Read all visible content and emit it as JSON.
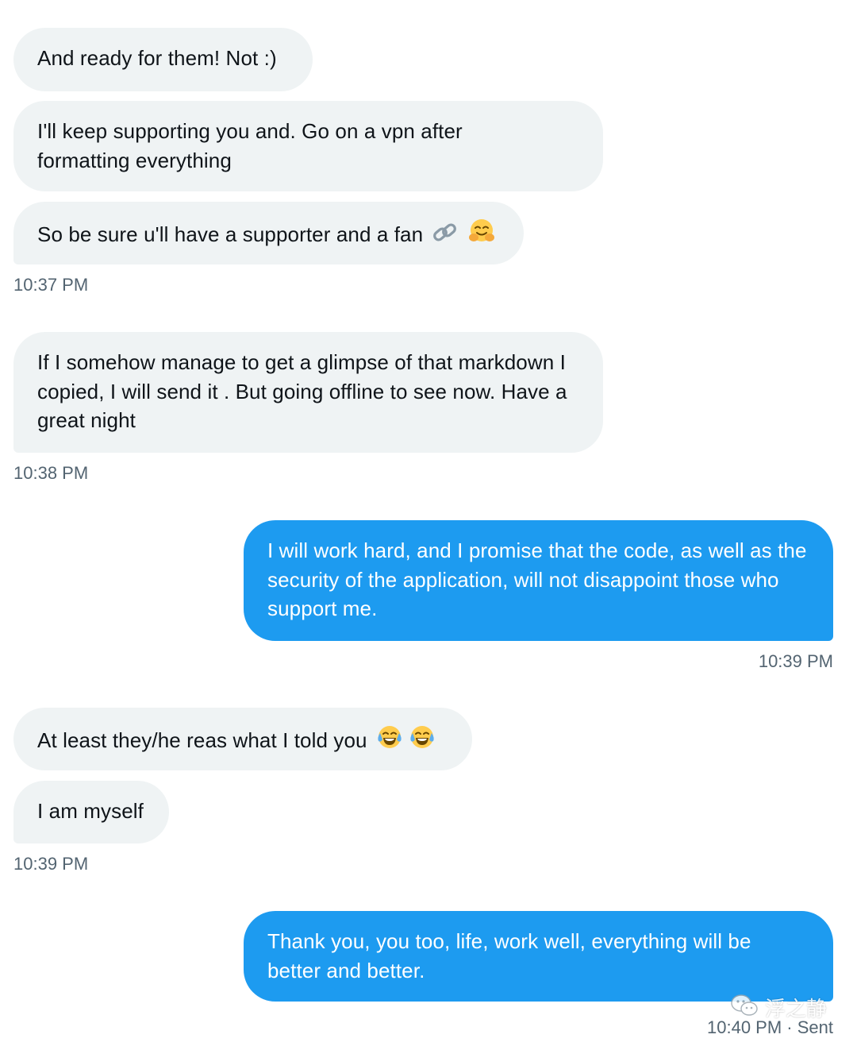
{
  "messages": [
    {
      "text": "And ready for them! Not :)"
    },
    {
      "text": "I'll keep supporting you and. Go on a vpn after formatting everything"
    },
    {
      "text": "So be sure u'll have a supporter and a fan"
    },
    {
      "time": "10:37 PM"
    },
    {
      "text": "If I somehow manage to get a glimpse of that markdown I copied, I will send it . But going offline to see now. Have a great night"
    },
    {
      "time": "10:38 PM"
    },
    {
      "text": "I will work hard, and I promise that the code, as well as the security of the application, will not disappoint those who support me."
    },
    {
      "time": "10:39 PM"
    },
    {
      "text": "At least they/he reas what I told you"
    },
    {
      "text": "I am myself"
    },
    {
      "time": "10:39 PM"
    },
    {
      "text": "Thank you, you too, life, work well, everything will be better and better."
    },
    {
      "time": "10:40 PM · Sent"
    }
  ],
  "emoji": {
    "link": "link-icon",
    "hug": "hugging-face-icon",
    "laugh": "tears-of-joy-icon"
  },
  "watermark": {
    "text": "浮之静",
    "icon": "wechat-icon"
  },
  "colors": {
    "incoming_bg": "#eff3f4",
    "outgoing_bg": "#1d9bf0",
    "timestamp": "#536471"
  }
}
